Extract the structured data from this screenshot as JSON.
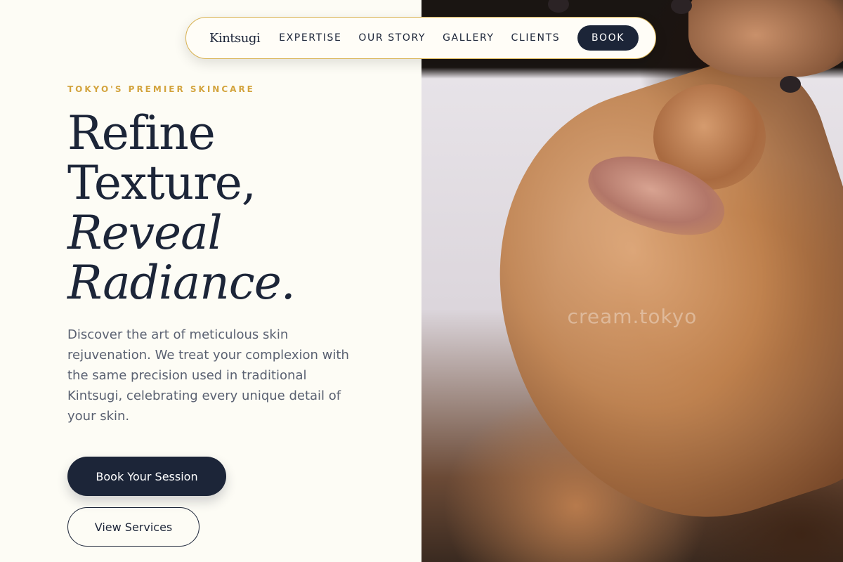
{
  "nav": {
    "logo": "Kintsugi",
    "links": [
      "EXPERTISE",
      "OUR STORY",
      "GALLERY",
      "CLIENTS"
    ],
    "book_label": "BOOK"
  },
  "hero": {
    "eyebrow": "TOKYO'S PREMIER SKINCARE",
    "headline": {
      "line1": "Refine",
      "line2": "Texture,",
      "line3": "Reveal",
      "line4": "Radiance."
    },
    "description": "Discover the art of meticulous skin rejuvenation. We treat your complexion with the same precision used in traditional Kintsugi, celebrating every unique detail of your skin.",
    "primary_cta": "Book Your Session",
    "secondary_cta": "View Services"
  },
  "image": {
    "watermark": "cream.tokyo"
  },
  "colors": {
    "navy": "#1c2538",
    "gold": "#d3a43e",
    "cream": "#fdfcf5"
  }
}
